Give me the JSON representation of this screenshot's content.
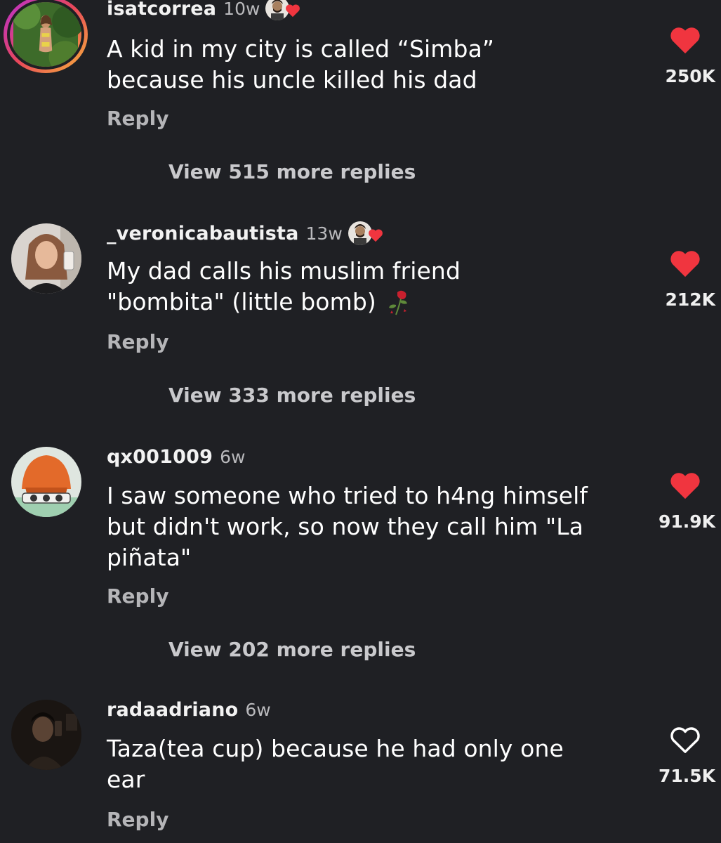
{
  "colors": {
    "background": "#1f2024",
    "like_red": "#f0353f",
    "text": "#ffffff",
    "muted": "#b5b5b8"
  },
  "comments": [
    {
      "username": "isatcorrea",
      "time": "10w",
      "creator_liked": true,
      "text_lines": [
        "A kid in my city is called “Simba”",
        "because his uncle killed his dad"
      ],
      "reply_label": "Reply",
      "view_more": "View 515 more replies",
      "likes": "250K",
      "liked": true,
      "avatar_icon": "story-ring-avatar"
    },
    {
      "username": "_veronicabautista",
      "time": "13w",
      "creator_liked": true,
      "text_lines": [
        "My dad calls his muslim friend",
        "\"bombita\" (little bomb)"
      ],
      "text_emoji": "wilted-rose-icon",
      "reply_label": "Reply",
      "view_more": "View 333 more replies",
      "likes": "212K",
      "liked": true,
      "avatar_icon": "photo-avatar"
    },
    {
      "username": "qx001009",
      "time": "6w",
      "creator_liked": false,
      "text_lines": [
        "I saw someone who tried to h4ng himself",
        "but didn't work, so now they call him \"La",
        "piñata\""
      ],
      "reply_label": "Reply",
      "view_more": "View 202 more replies",
      "likes": "91.9K",
      "liked": true,
      "avatar_icon": "cartoon-avatar"
    },
    {
      "username": "radaadriano",
      "time": "6w",
      "creator_liked": false,
      "text_lines": [
        "Taza(tea cup) because he had only one",
        "ear"
      ],
      "reply_label": "Reply",
      "likes": "71.5K",
      "liked": false,
      "avatar_icon": "photo-avatar"
    }
  ]
}
